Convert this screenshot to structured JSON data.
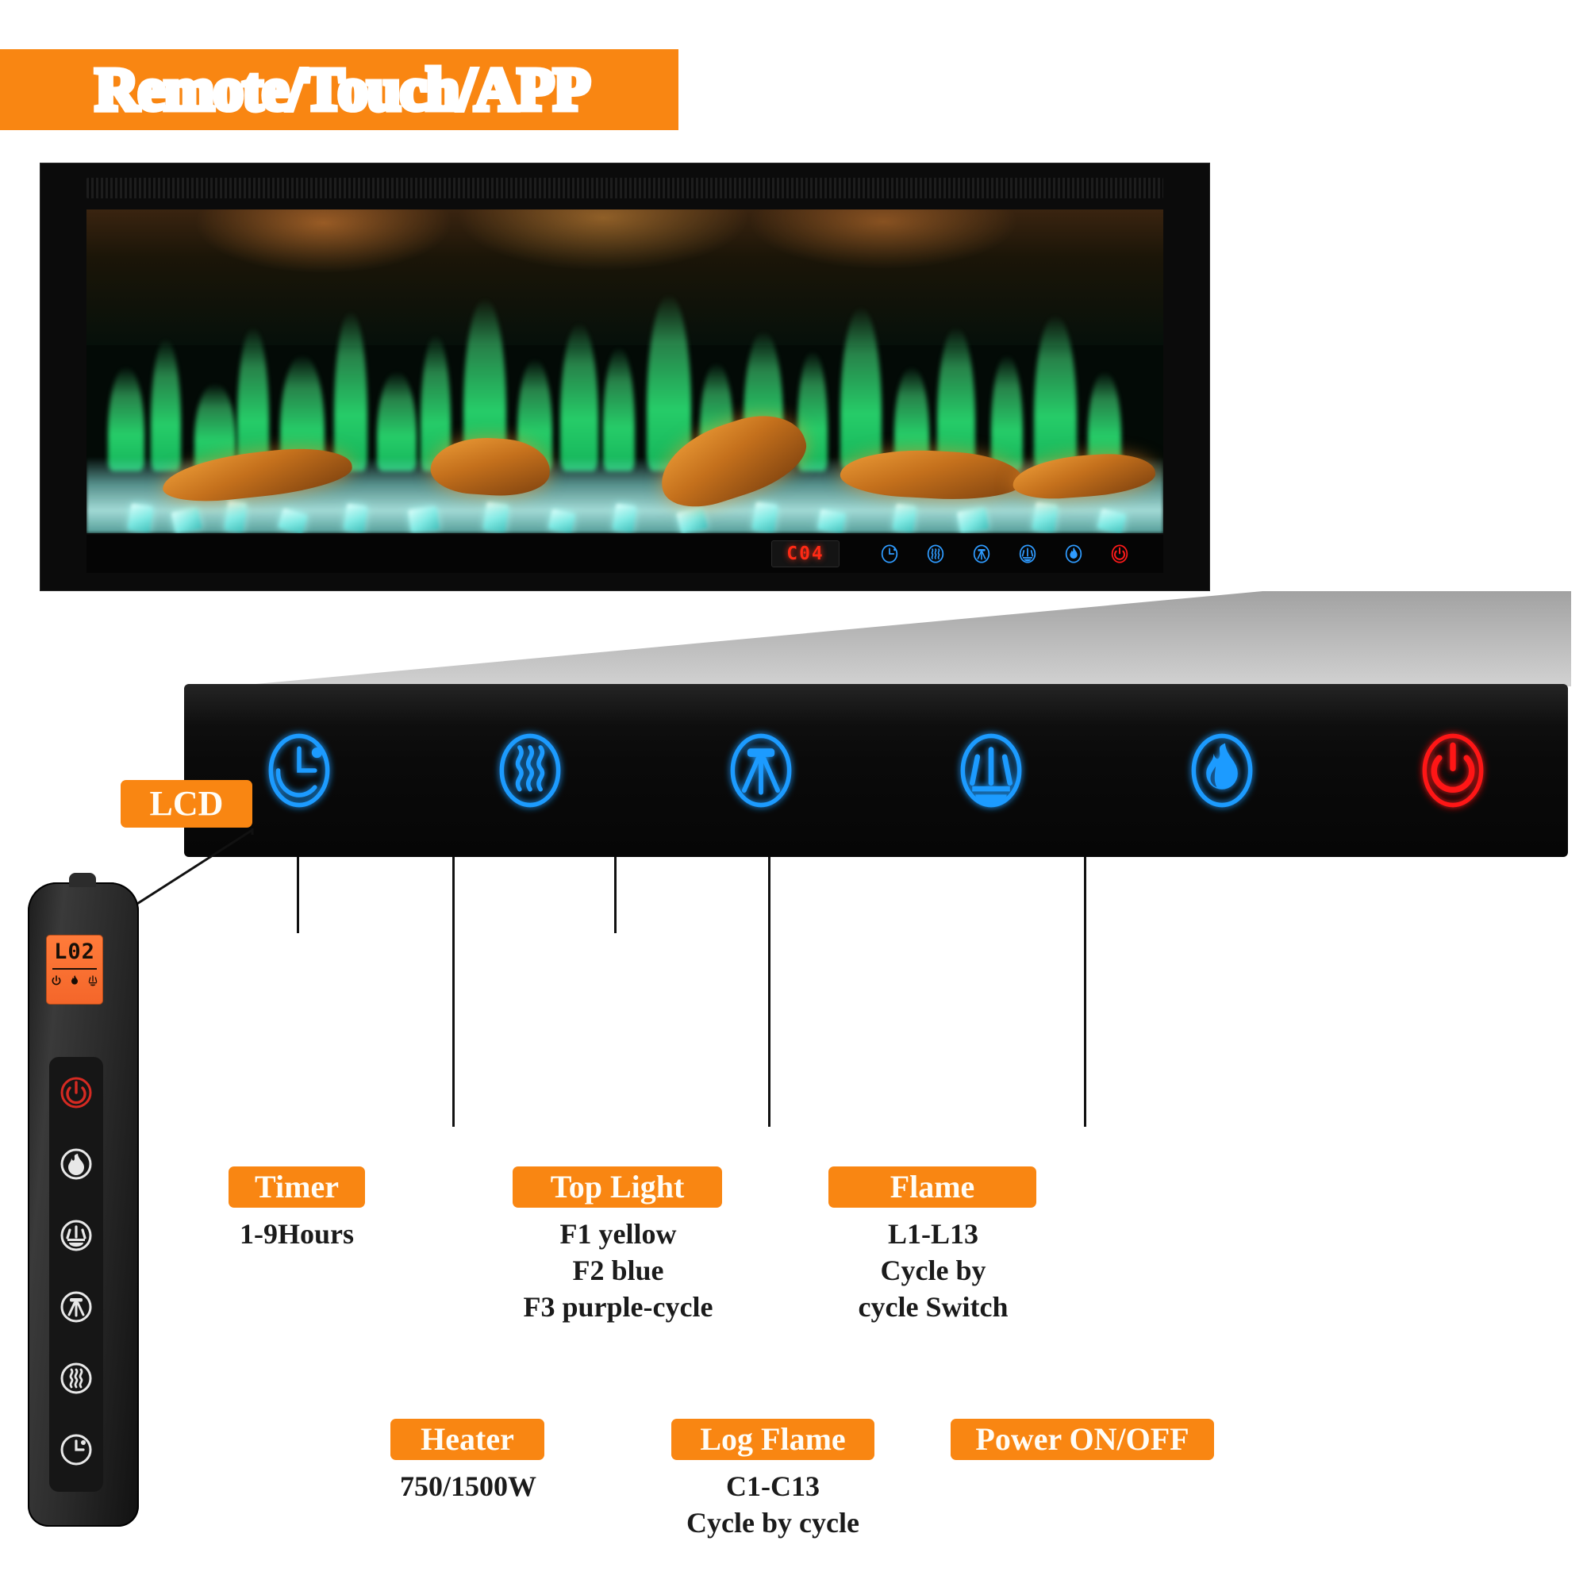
{
  "header": {
    "title": "Remote/Touch/APP",
    "accent_color": "#F98612"
  },
  "fireplace": {
    "led_display": "C04",
    "strip_icons": [
      {
        "name": "timer-icon",
        "color": "#2f9bff"
      },
      {
        "name": "heater-icon",
        "color": "#2f9bff"
      },
      {
        "name": "top-light-icon",
        "color": "#2f9bff"
      },
      {
        "name": "log-flame-icon",
        "color": "#2f9bff"
      },
      {
        "name": "flame-icon",
        "color": "#2f9bff"
      },
      {
        "name": "power-icon",
        "color": "#ff1a1a"
      }
    ]
  },
  "remote": {
    "lcd_badge_label": "LCD",
    "lcd_value": "L02",
    "lcd_icons": [
      "power-icon",
      "flame-icon",
      "log-flame-icon"
    ],
    "buttons": [
      {
        "name": "power-button",
        "icon": "power-icon",
        "color": "#d52a22"
      },
      {
        "name": "flame-button",
        "icon": "flame-icon",
        "color": "#e8e8e8"
      },
      {
        "name": "log-flame-button",
        "icon": "log-flame-icon",
        "color": "#e8e8e8"
      },
      {
        "name": "top-light-button",
        "icon": "top-light-icon",
        "color": "#e8e8e8"
      },
      {
        "name": "heater-button",
        "icon": "heater-icon",
        "color": "#e8e8e8"
      },
      {
        "name": "timer-button",
        "icon": "timer-icon",
        "color": "#e8e8e8"
      }
    ]
  },
  "panel": {
    "buttons": [
      {
        "name": "timer-button",
        "icon": "timer-icon",
        "color": "#1f9bff"
      },
      {
        "name": "heater-button",
        "icon": "heater-icon",
        "color": "#1f9bff"
      },
      {
        "name": "top-light-button",
        "icon": "top-light-icon",
        "color": "#1f9bff"
      },
      {
        "name": "log-flame-button",
        "icon": "log-flame-icon",
        "color": "#1f9bff"
      },
      {
        "name": "flame-button",
        "icon": "flame-icon",
        "color": "#1f9bff"
      },
      {
        "name": "power-button",
        "icon": "power-icon",
        "color": "#ff1717"
      }
    ]
  },
  "callouts": {
    "timer": {
      "label": "Timer",
      "detail": "1-9Hours"
    },
    "heater": {
      "label": "Heater",
      "detail": "750/1500W"
    },
    "top_light": {
      "label": "Top Light",
      "detail": "F1 yellow\nF2 blue\nF3 purple-cycle"
    },
    "log_flame": {
      "label": "Log Flame",
      "detail": "C1-C13\nCycle by cycle"
    },
    "flame": {
      "label": "Flame",
      "detail": "L1-L13\nCycle by\ncycle Switch"
    },
    "power": {
      "label": "Power ON/OFF",
      "detail": ""
    }
  }
}
